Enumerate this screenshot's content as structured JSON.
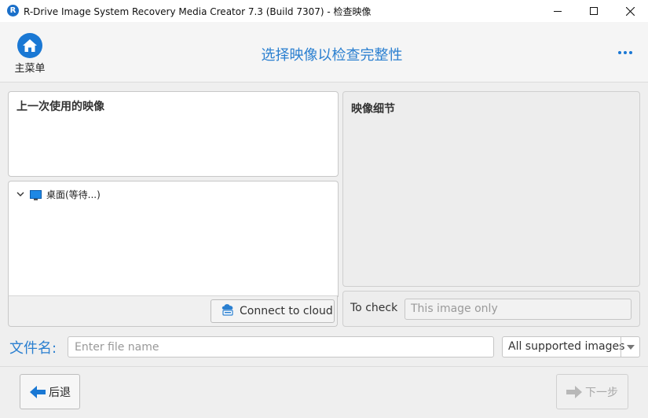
{
  "window": {
    "app_icon_letter": "R",
    "title": "R-Drive Image System Recovery Media Creator 7.3 (Build 7307) - 检查映像"
  },
  "header": {
    "home_label": "主菜单",
    "page_title": "选择映像以检查完整性"
  },
  "recent_images": {
    "heading": "上一次使用的映像"
  },
  "tree": {
    "items": [
      {
        "label": "桌面(等待...)",
        "expanded": true
      }
    ],
    "connect_cloud_label": "Connect to cloud"
  },
  "image_details": {
    "heading": "映像细节"
  },
  "to_check": {
    "label": "To check",
    "value": "This image only"
  },
  "file_name": {
    "label": "文件名:",
    "placeholder": "Enter file name",
    "type_selected": "All supported images"
  },
  "footer": {
    "back_label": "后退",
    "next_label": "下一步"
  },
  "colors": {
    "accent": "#2a7fd0",
    "home_circle": "#1a78d4"
  }
}
